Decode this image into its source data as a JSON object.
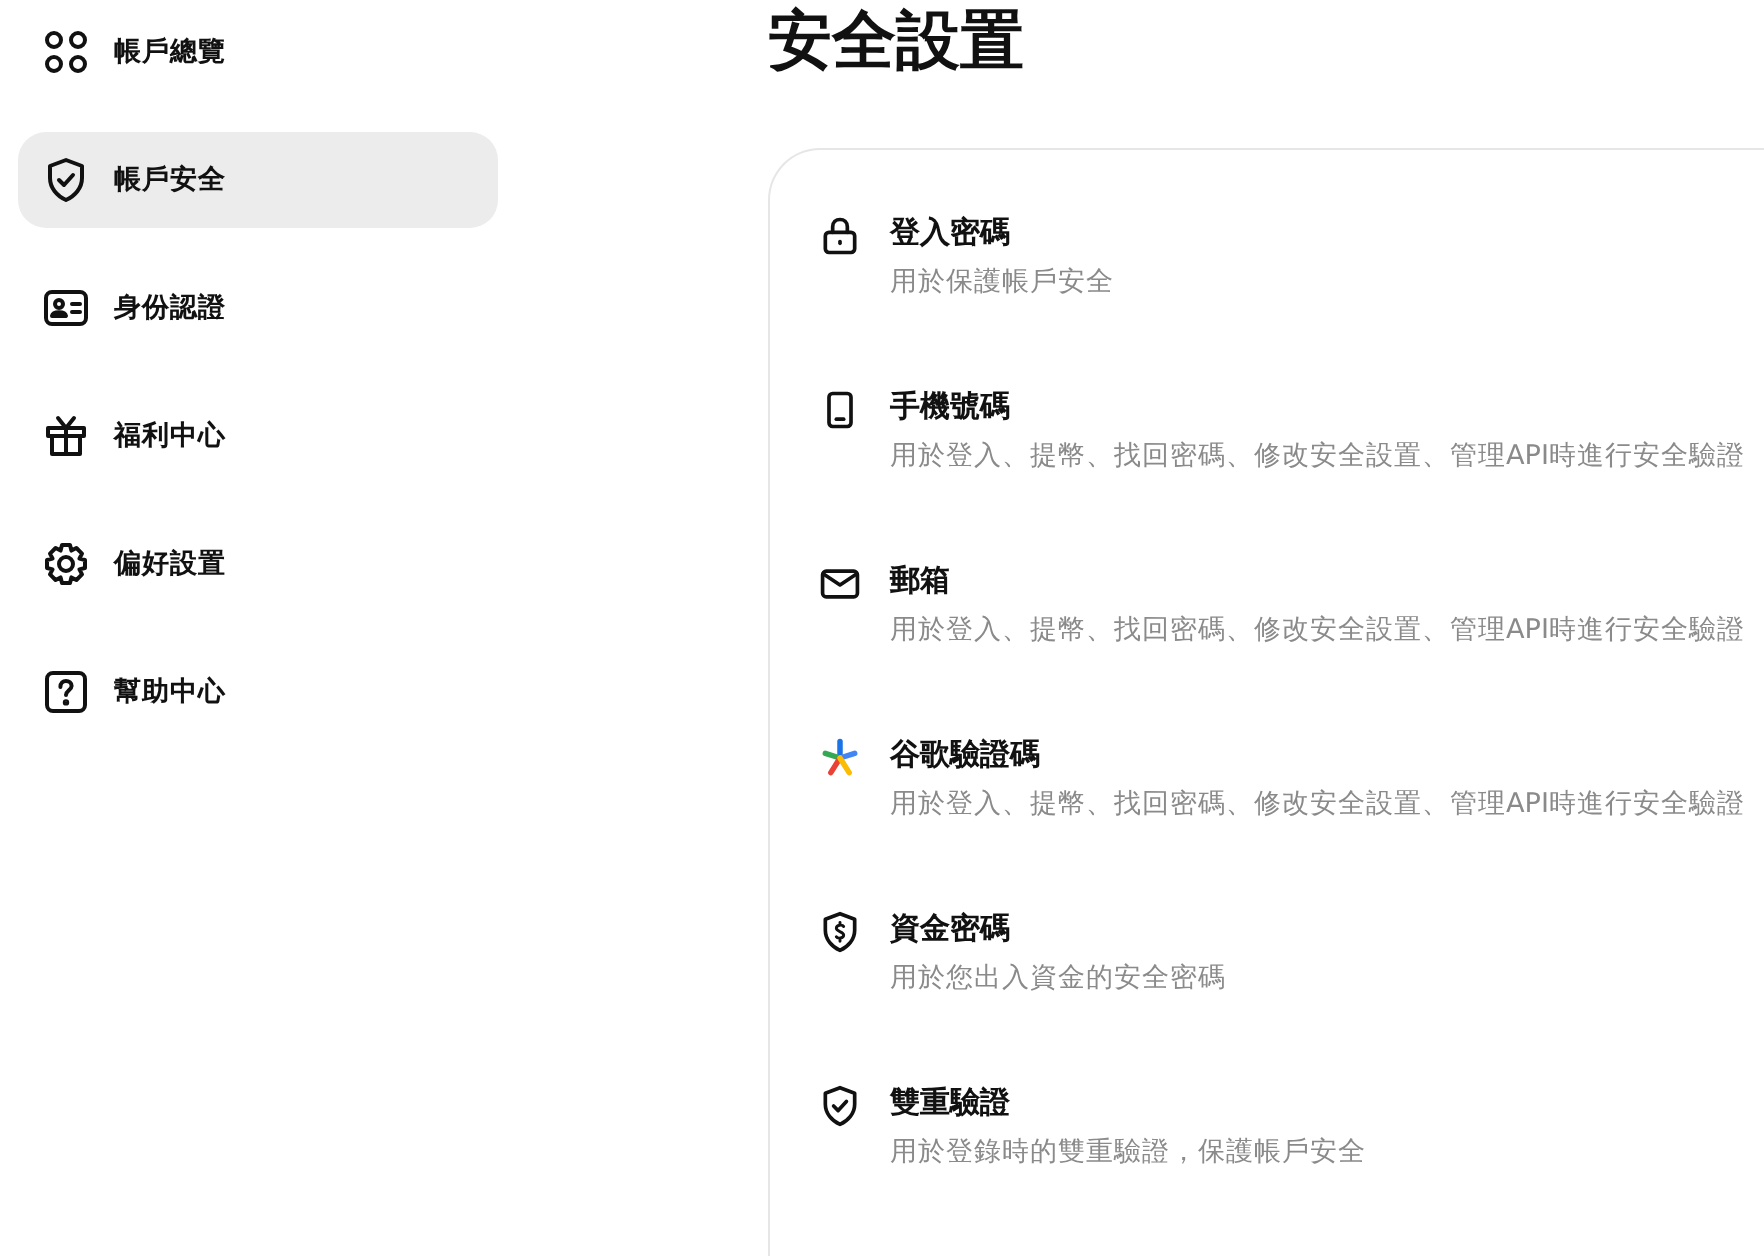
{
  "sidebar": {
    "items": [
      {
        "label": "帳戶總覽",
        "selected": false
      },
      {
        "label": "帳戶安全",
        "selected": true
      },
      {
        "label": "身份認證",
        "selected": false
      },
      {
        "label": "福利中心",
        "selected": false
      },
      {
        "label": "偏好設置",
        "selected": false
      },
      {
        "label": "幫助中心",
        "selected": false
      }
    ]
  },
  "page_title": "安全設置",
  "settings": [
    {
      "title": "登入密碼",
      "description": "用於保護帳戶安全"
    },
    {
      "title": "手機號碼",
      "description": "用於登入、提幣、找回密碼、修改安全設置、管理API時進行安全驗證"
    },
    {
      "title": "郵箱",
      "description": "用於登入、提幣、找回密碼、修改安全設置、管理API時進行安全驗證"
    },
    {
      "title": "谷歌驗證碼",
      "description": "用於登入、提幣、找回密碼、修改安全設置、管理API時進行安全驗證"
    },
    {
      "title": "資金密碼",
      "description": "用於您出入資金的安全密碼"
    },
    {
      "title": "雙重驗證",
      "description": "用於登錄時的雙重驗證，保護帳戶安全"
    }
  ]
}
